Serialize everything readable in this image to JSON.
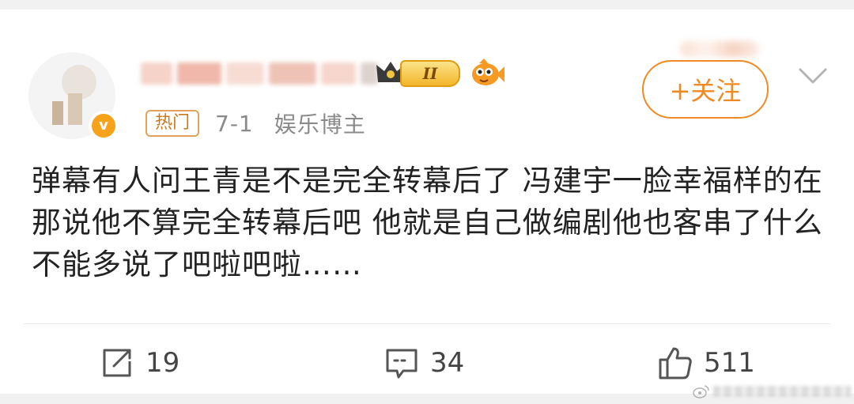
{
  "post": {
    "tag_hot": "热门",
    "date": "7-1",
    "user_type": "娱乐博主",
    "level_badge": "II",
    "follow_label": "+关注",
    "text": "弹幕有人问王青是不是完全转幕后了 冯建宇一脸幸福样的在那说他不算完全转幕后吧 他就是自己做编剧他也客串了什么不能多说了吧啦吧啦……"
  },
  "actions": {
    "reposts": "19",
    "comments": "34",
    "likes": "511"
  },
  "colors": {
    "accent": "#f08a24",
    "hot_tag": "#c77a22",
    "meta_text": "#8a8a8a",
    "body_text": "#222222"
  },
  "icons": [
    "chevron-down-icon",
    "repost-icon",
    "comment-icon",
    "like-icon",
    "verified-badge-icon",
    "level-crown-icon",
    "fish-emblem-icon",
    "weibo-logo-icon"
  ]
}
